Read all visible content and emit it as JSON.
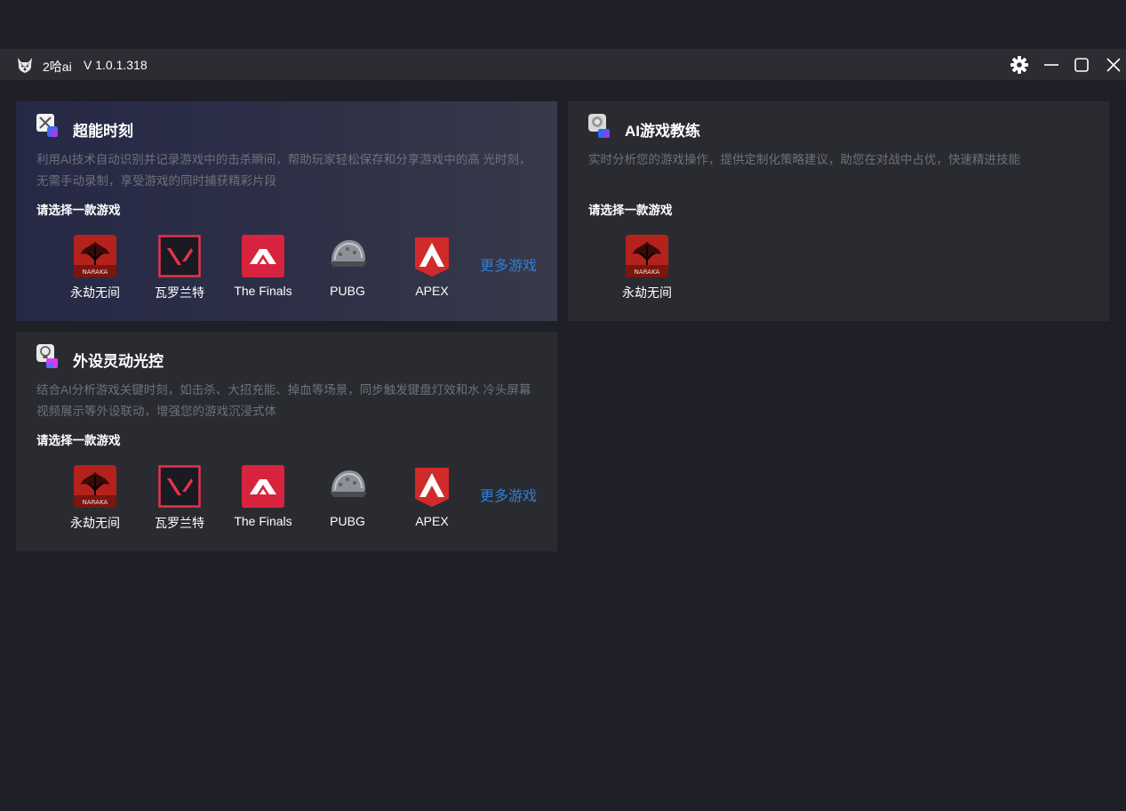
{
  "app": {
    "name": "2哈ai",
    "version": "V 1.0.1.318",
    "icons": {
      "logo": "husky-logo-icon",
      "settings": "gear-icon",
      "minimize": "minimize-icon",
      "maximize": "maximize-icon",
      "close": "close-icon"
    }
  },
  "cards": [
    {
      "id": "highlight-moments",
      "icon": "crossed-swords-icon",
      "title": "超能时刻",
      "description": "利用AI技术自动识别并记录游戏中的击杀瞬间，帮助玩家轻松保存和分享游戏中的高 光时刻，无需手动录制，享受游戏的同时捕获精彩片段",
      "prompt": "请选择一款游戏",
      "games": [
        "永劫无间",
        "瓦罗兰特",
        "The Finals",
        "PUBG",
        "APEX"
      ],
      "more": "更多游戏"
    },
    {
      "id": "ai-coach",
      "icon": "coach-robot-icon",
      "title": "AI游戏教练",
      "description": "实时分析您的游戏操作，提供定制化策略建议，助您在对战中占优，快速精进技能",
      "prompt": "请选择一款游戏",
      "games": [
        "永劫无间"
      ],
      "more": ""
    },
    {
      "id": "peripheral-lighting",
      "icon": "light-bulb-icon",
      "title": "外设灵动光控",
      "description": "结合AI分析游戏关键时刻，如击杀、大招充能、掉血等场景，同步触发键盘灯效和水 冷头屏幕视频展示等外设联动，增强您的游戏沉浸式体",
      "prompt": "请选择一款游戏",
      "games": [
        "永劫无间",
        "瓦罗兰特",
        "The Finals",
        "PUBG",
        "APEX"
      ],
      "more": "更多游戏"
    }
  ],
  "game_icons": {
    "永劫无间": "naraka-icon",
    "瓦罗兰特": "valorant-icon",
    "The Finals": "the-finals-icon",
    "PUBG": "pubg-helmet-icon",
    "APEX": "apex-icon"
  },
  "colors": {
    "background": "#1f1f28",
    "titlebar": "#2c2d33",
    "card": "#2a2b31",
    "card_highlight_start": "#262946",
    "link": "#2f7fd6",
    "description": "#6f717a",
    "naraka_red": "#c0261f",
    "valorant_red": "#e5334a",
    "finals_red": "#d8233f",
    "apex_red": "#d12a2a"
  },
  "naraka_badge_text": "NARAKA"
}
